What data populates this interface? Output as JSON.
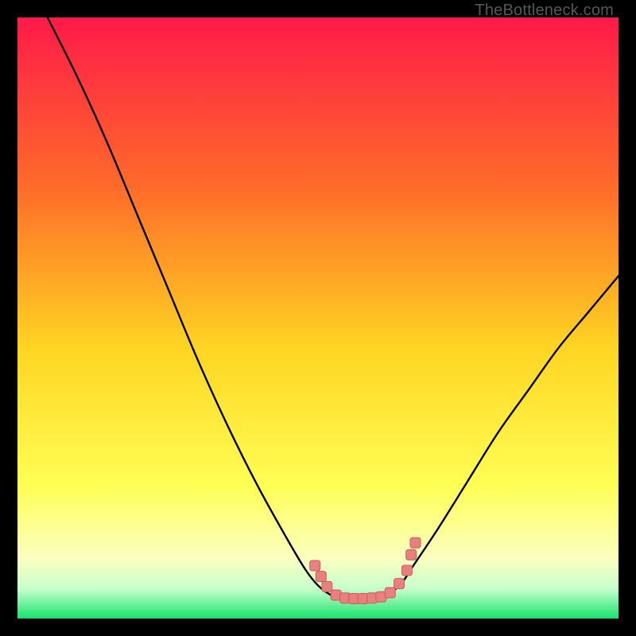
{
  "watermark": "TheBottleneck.com",
  "colors": {
    "frame": "#000000",
    "grad_top": "#ff1a49",
    "grad_mid_upper": "#ff6a2a",
    "grad_mid": "#ffd522",
    "grad_mid_lower": "#ffff55",
    "grad_lower": "#fbffc0",
    "grad_band": "#c8ffcd",
    "grad_bottom": "#18e26e",
    "curve": "#000000",
    "marker_fill": "#e98080",
    "marker_stroke": "#cf5a5a"
  },
  "chart_data": {
    "type": "line",
    "title": "",
    "xlabel": "",
    "ylabel": "",
    "xlim": [
      0,
      100
    ],
    "ylim": [
      0,
      100
    ],
    "curve": [
      [
        5,
        100
      ],
      [
        10,
        90
      ],
      [
        15,
        79
      ],
      [
        20,
        67
      ],
      [
        25,
        55
      ],
      [
        30,
        43
      ],
      [
        35,
        32
      ],
      [
        40,
        22
      ],
      [
        45,
        13
      ],
      [
        48,
        8
      ],
      [
        50,
        5.5
      ],
      [
        52,
        4
      ],
      [
        54,
        3.4
      ],
      [
        56,
        3.3
      ],
      [
        58,
        3.3
      ],
      [
        60,
        3.4
      ],
      [
        62,
        4.2
      ],
      [
        64,
        6
      ],
      [
        66,
        9
      ],
      [
        70,
        15
      ],
      [
        75,
        23
      ],
      [
        80,
        31
      ],
      [
        85,
        38
      ],
      [
        90,
        45
      ],
      [
        95,
        51
      ],
      [
        100,
        57
      ]
    ],
    "markers": [
      [
        49.5,
        8.8
      ],
      [
        50.5,
        7.0
      ],
      [
        51.5,
        5.3
      ],
      [
        53.0,
        3.9
      ],
      [
        54.5,
        3.4
      ],
      [
        56.0,
        3.3
      ],
      [
        57.5,
        3.3
      ],
      [
        59.0,
        3.4
      ],
      [
        60.5,
        3.6
      ],
      [
        62.0,
        4.3
      ],
      [
        63.5,
        5.8
      ],
      [
        64.8,
        8.0
      ],
      [
        65.5,
        10.6
      ],
      [
        66.2,
        12.6
      ]
    ]
  }
}
